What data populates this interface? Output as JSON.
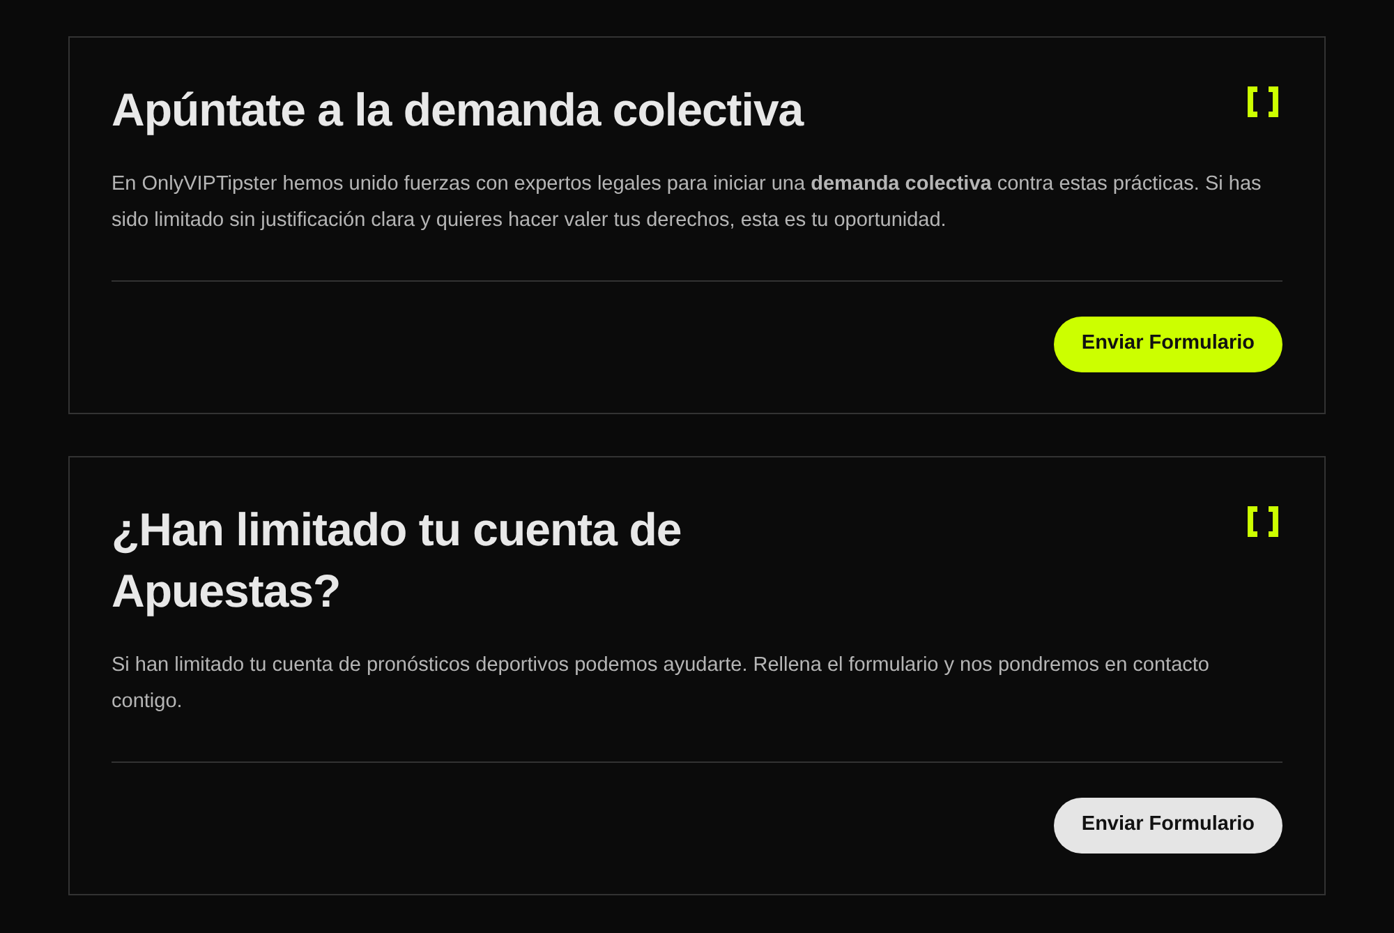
{
  "cards": [
    {
      "title": "Apúntate a la demanda colectiva",
      "text": "En OnlyVIPTipster hemos unido fuerzas con expertos legales para iniciar una **demanda colectiva** contra estas prácticas. Si has sido limitado sin justificación clara y quieres hacer valer tus derechos, esta es tu oportunidad.",
      "button": {
        "label": "Enviar Formulario",
        "kind": "primary"
      }
    },
    {
      "title": "¿Han limitado tu cuenta de Apuestas?",
      "text": "Si han limitado tu cuenta de pronósticos deportivos podemos ayudarte. Rellena el formulario y nos pondremos en contacto contigo.",
      "button": {
        "label": "Enviar Formulario",
        "kind": "secondary"
      }
    }
  ]
}
